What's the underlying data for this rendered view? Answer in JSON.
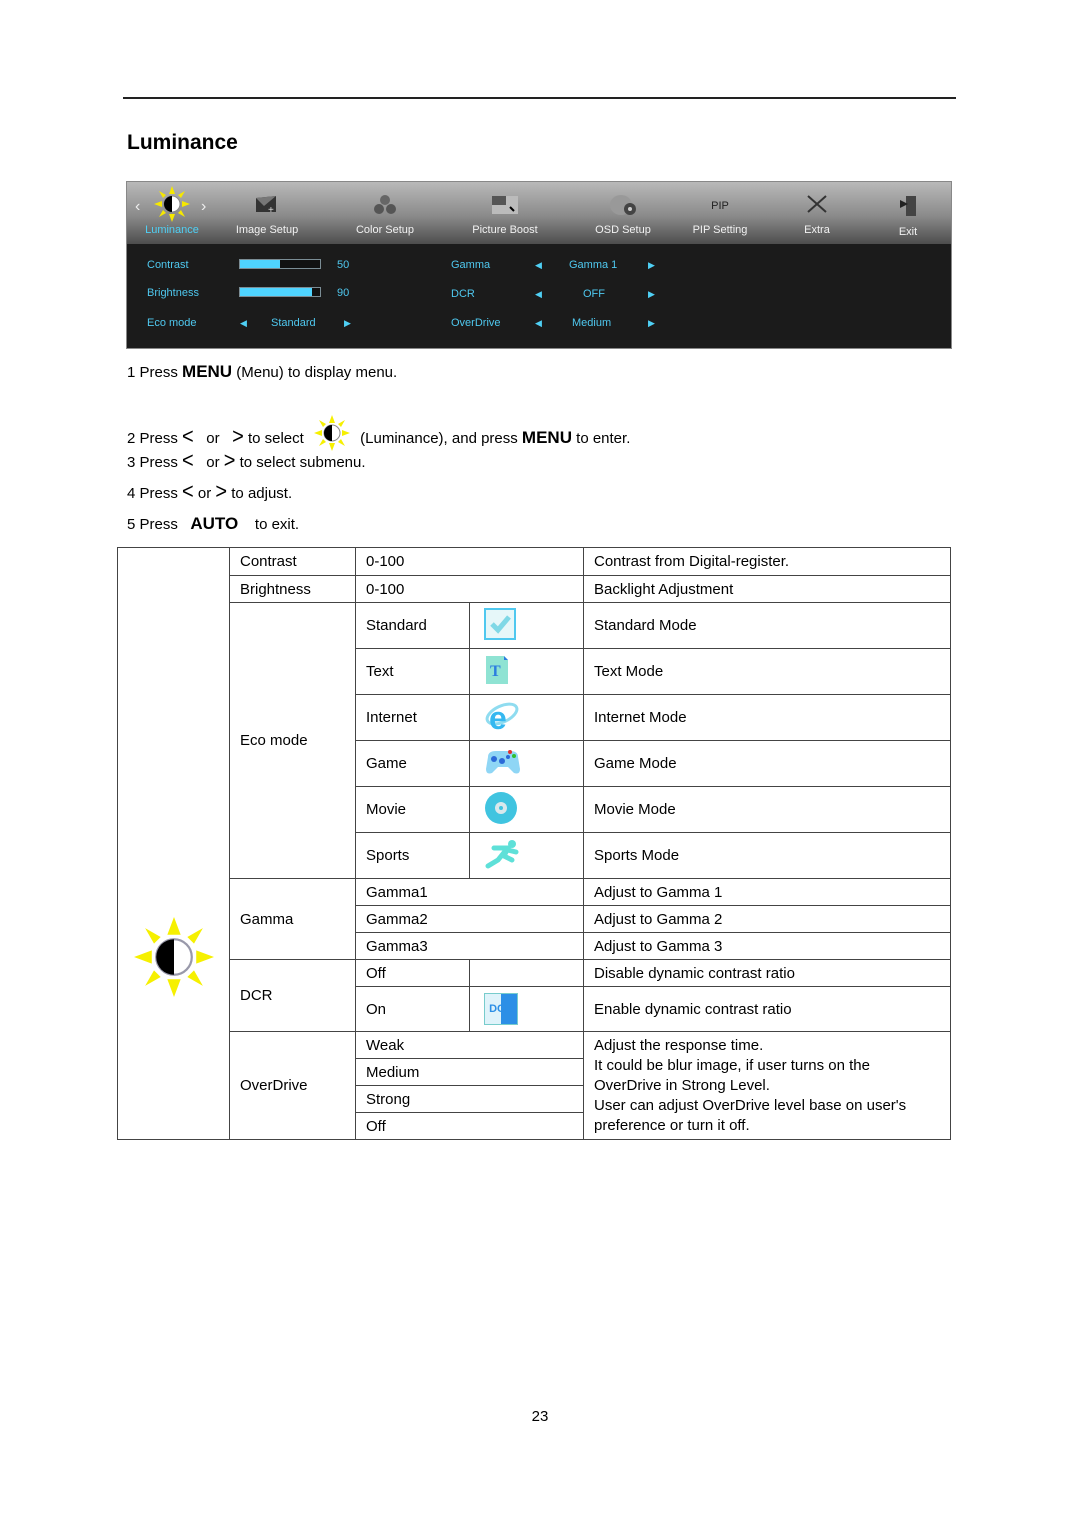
{
  "page": {
    "title": "Luminance",
    "page_number": "23"
  },
  "osd": {
    "tabs": [
      {
        "label": "Luminance",
        "icon": "sun-half-icon",
        "active": true
      },
      {
        "label": "Image Setup",
        "icon": "image-setup-icon"
      },
      {
        "label": "Color Setup",
        "icon": "color-balls-icon"
      },
      {
        "label": "Picture Boost",
        "icon": "picture-boost-icon"
      },
      {
        "label": "OSD Setup",
        "icon": "osd-globe-icon"
      },
      {
        "label": "PIP Setting",
        "icon": "pip-icon",
        "icon_text": "PIP"
      },
      {
        "label": "Extra",
        "icon": "tools-icon"
      },
      {
        "label": "Exit",
        "icon": "exit-door-icon"
      }
    ],
    "left": {
      "contrast": {
        "label": "Contrast",
        "value": "50",
        "fraction": 0.5
      },
      "brightness": {
        "label": "Brightness",
        "value": "90",
        "fraction": 0.9
      },
      "eco": {
        "label": "Eco mode",
        "value": "Standard"
      }
    },
    "right": {
      "gamma": {
        "label": "Gamma",
        "value": "Gamma 1"
      },
      "dcr": {
        "label": "DCR",
        "value": "OFF"
      },
      "overdrive": {
        "label": "OverDrive",
        "value": "Medium"
      }
    },
    "colors": {
      "accent": "#4fd0f5",
      "bg": "#1b1b1b"
    }
  },
  "instructions": {
    "s1": {
      "pre": "1 Press ",
      "key": "MENU",
      "post": " (Menu) to display menu."
    },
    "s2": {
      "pre": "2 Press ",
      "or": "or",
      "mid": "to select",
      "post": "(Luminance), and press ",
      "key": "MENU",
      "end": " to enter."
    },
    "s3": {
      "pre": "3 Press ",
      "or": "or",
      "post": "to select submenu."
    },
    "s4": {
      "pre": "4 Press ",
      "or": "or",
      "post": "to adjust."
    },
    "s5": {
      "pre": "5 Press ",
      "key": "AUTO",
      "post": "to exit."
    },
    "left_arrow": "<",
    "right_arrow": ">"
  },
  "table": {
    "contrast": {
      "name": "Contrast",
      "range": "0-100",
      "desc": "Contrast from Digital-register."
    },
    "brightness": {
      "name": "Brightness",
      "range": "0-100",
      "desc": "Backlight Adjustment"
    },
    "eco": {
      "name": "Eco mode",
      "modes": [
        {
          "name": "Standard",
          "icon": "check-icon",
          "desc": "Standard Mode"
        },
        {
          "name": "Text",
          "icon": "text-doc-icon",
          "desc": "Text Mode"
        },
        {
          "name": "Internet",
          "icon": "internet-explorer-icon",
          "desc": "Internet Mode"
        },
        {
          "name": "Game",
          "icon": "gamepad-icon",
          "desc": "Game Mode"
        },
        {
          "name": "Movie",
          "icon": "disc-icon",
          "desc": "Movie Mode"
        },
        {
          "name": "Sports",
          "icon": "runner-icon",
          "desc": "Sports Mode"
        }
      ]
    },
    "gamma": {
      "name": "Gamma",
      "rows": [
        {
          "name": "Gamma1",
          "desc": "Adjust to Gamma 1"
        },
        {
          "name": "Gamma2",
          "desc": "Adjust to Gamma 2"
        },
        {
          "name": "Gamma3",
          "desc": "Adjust to Gamma 3"
        }
      ]
    },
    "dcr": {
      "name": "DCR",
      "rows": [
        {
          "name": "Off",
          "desc": "Disable dynamic contrast ratio"
        },
        {
          "name": "On",
          "icon_text": "DCR",
          "desc": "Enable dynamic contrast ratio"
        }
      ]
    },
    "overdrive": {
      "name": "OverDrive",
      "levels": [
        "Weak",
        "Medium",
        "Strong",
        "Off"
      ],
      "desc": [
        "Adjust the response time.",
        "It could be blur image, if user turns on the OverDrive in Strong Level.",
        "User can adjust OverDrive level base on user's preference or turn it off."
      ]
    }
  }
}
